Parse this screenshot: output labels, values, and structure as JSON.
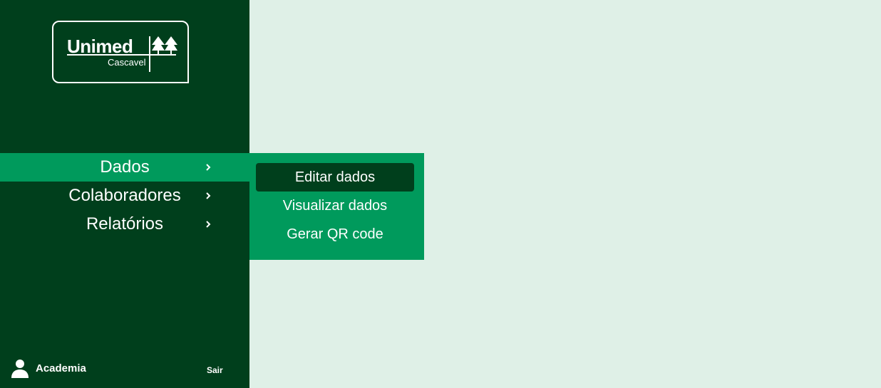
{
  "logo": {
    "brand": "Unimed",
    "subtitle": "Cascavel",
    "icon": "unimed-trees-icon"
  },
  "menu": {
    "items": [
      {
        "label": "Dados",
        "icon": "chevron-right-icon"
      },
      {
        "label": "Colaboradores",
        "icon": "chevron-right-icon"
      },
      {
        "label": "Relatórios",
        "icon": "chevron-right-icon"
      }
    ]
  },
  "submenu": {
    "items": [
      {
        "label": "Editar dados"
      },
      {
        "label": "Visualizar dados"
      },
      {
        "label": "Gerar QR code"
      }
    ]
  },
  "footer": {
    "user_name": "Academia",
    "user_icon": "person-icon",
    "logout_label": "Sair"
  },
  "colors": {
    "sidebar_bg": "#003f1c",
    "accent": "#009a5c",
    "content_bg": "#dff0e7",
    "text": "#ffffff"
  }
}
